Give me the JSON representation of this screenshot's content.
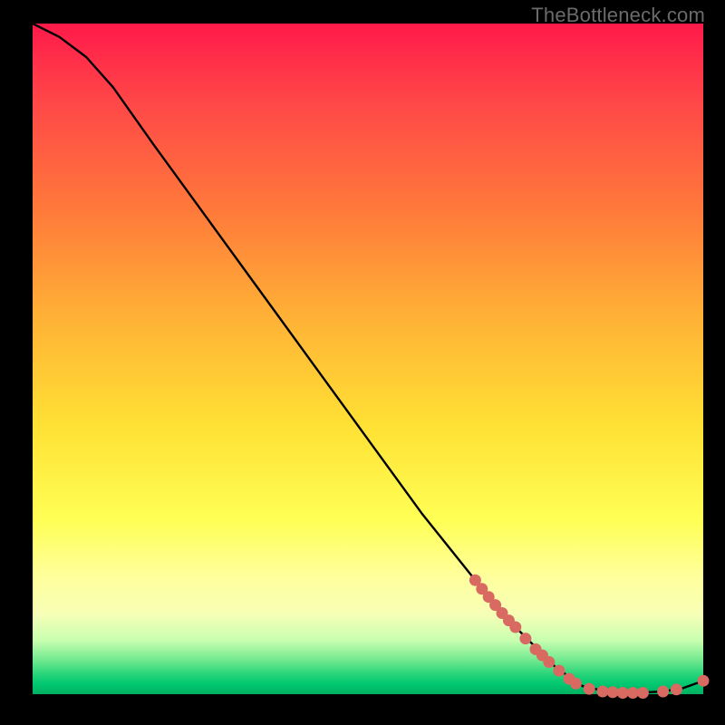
{
  "watermark": "TheBottleneck.com",
  "chart_data": {
    "type": "line",
    "title": "",
    "xlabel": "",
    "ylabel": "",
    "xlim": [
      0,
      100
    ],
    "ylim": [
      0,
      100
    ],
    "grid": false,
    "curve": [
      {
        "x": 0,
        "y": 100
      },
      {
        "x": 4,
        "y": 98
      },
      {
        "x": 8,
        "y": 95
      },
      {
        "x": 12,
        "y": 90.5
      },
      {
        "x": 18,
        "y": 82
      },
      {
        "x": 26,
        "y": 71
      },
      {
        "x": 34,
        "y": 60
      },
      {
        "x": 42,
        "y": 49
      },
      {
        "x": 50,
        "y": 38
      },
      {
        "x": 58,
        "y": 27
      },
      {
        "x": 66,
        "y": 17
      },
      {
        "x": 72,
        "y": 10
      },
      {
        "x": 78,
        "y": 4
      },
      {
        "x": 82,
        "y": 1.2
      },
      {
        "x": 86,
        "y": 0.3
      },
      {
        "x": 90,
        "y": 0.2
      },
      {
        "x": 94,
        "y": 0.4
      },
      {
        "x": 97,
        "y": 0.9
      },
      {
        "x": 100,
        "y": 2.0
      }
    ],
    "highlight_points": [
      {
        "x": 66,
        "y": 17
      },
      {
        "x": 67,
        "y": 15.7
      },
      {
        "x": 68,
        "y": 14.5
      },
      {
        "x": 69,
        "y": 13.3
      },
      {
        "x": 70,
        "y": 12.1
      },
      {
        "x": 71,
        "y": 11.0
      },
      {
        "x": 72,
        "y": 10.0
      },
      {
        "x": 73.5,
        "y": 8.3
      },
      {
        "x": 75,
        "y": 6.7
      },
      {
        "x": 76,
        "y": 5.8
      },
      {
        "x": 77,
        "y": 4.8
      },
      {
        "x": 78.5,
        "y": 3.5
      },
      {
        "x": 80,
        "y": 2.3
      },
      {
        "x": 81,
        "y": 1.6
      },
      {
        "x": 83,
        "y": 0.8
      },
      {
        "x": 85,
        "y": 0.4
      },
      {
        "x": 86.5,
        "y": 0.3
      },
      {
        "x": 88,
        "y": 0.2
      },
      {
        "x": 89.5,
        "y": 0.2
      },
      {
        "x": 91,
        "y": 0.2
      },
      {
        "x": 94,
        "y": 0.4
      },
      {
        "x": 96,
        "y": 0.7
      },
      {
        "x": 100,
        "y": 2.0
      }
    ],
    "highlight_color": "#d86a62",
    "line_color": "#000000"
  }
}
